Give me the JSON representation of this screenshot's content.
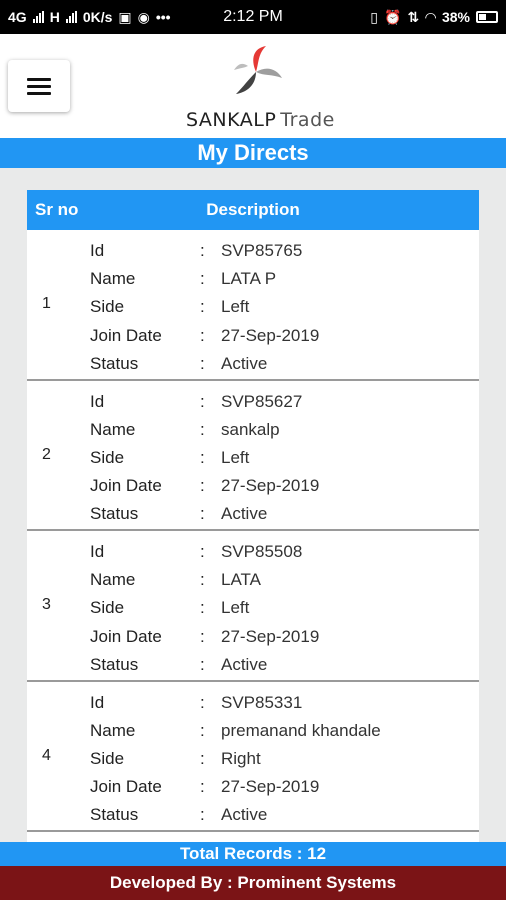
{
  "status_bar": {
    "network": "4G",
    "network2": "H",
    "speed": "0K/s",
    "time": "2:12 PM",
    "battery": "38%"
  },
  "header": {
    "brand": "SANKALP",
    "brand_suffix": "Trade",
    "logo_colors": [
      "#e53935",
      "#9e9e9e",
      "#424242"
    ]
  },
  "title": "My Directs",
  "table": {
    "col_sr": "Sr no",
    "col_desc": "Description",
    "labels": {
      "id": "Id",
      "name": "Name",
      "side": "Side",
      "join_date": "Join Date",
      "status": "Status"
    },
    "colon": ":",
    "rows": [
      {
        "sr": "1",
        "id": "SVP85765",
        "name": "LATA P",
        "side": "Left",
        "join_date": "27-Sep-2019",
        "status": "Active"
      },
      {
        "sr": "2",
        "id": "SVP85627",
        "name": "sankalp",
        "side": "Left",
        "join_date": "27-Sep-2019",
        "status": "Active"
      },
      {
        "sr": "3",
        "id": "SVP85508",
        "name": "LATA",
        "side": "Left",
        "join_date": "27-Sep-2019",
        "status": "Active"
      },
      {
        "sr": "4",
        "id": "SVP85331",
        "name": "premanand khandale",
        "side": "Right",
        "join_date": "27-Sep-2019",
        "status": "Active"
      }
    ]
  },
  "total": "Total Records : 12",
  "footer": "Developed By : Prominent Systems",
  "colors": {
    "primary": "#2196f3",
    "footer": "#7b1416"
  }
}
